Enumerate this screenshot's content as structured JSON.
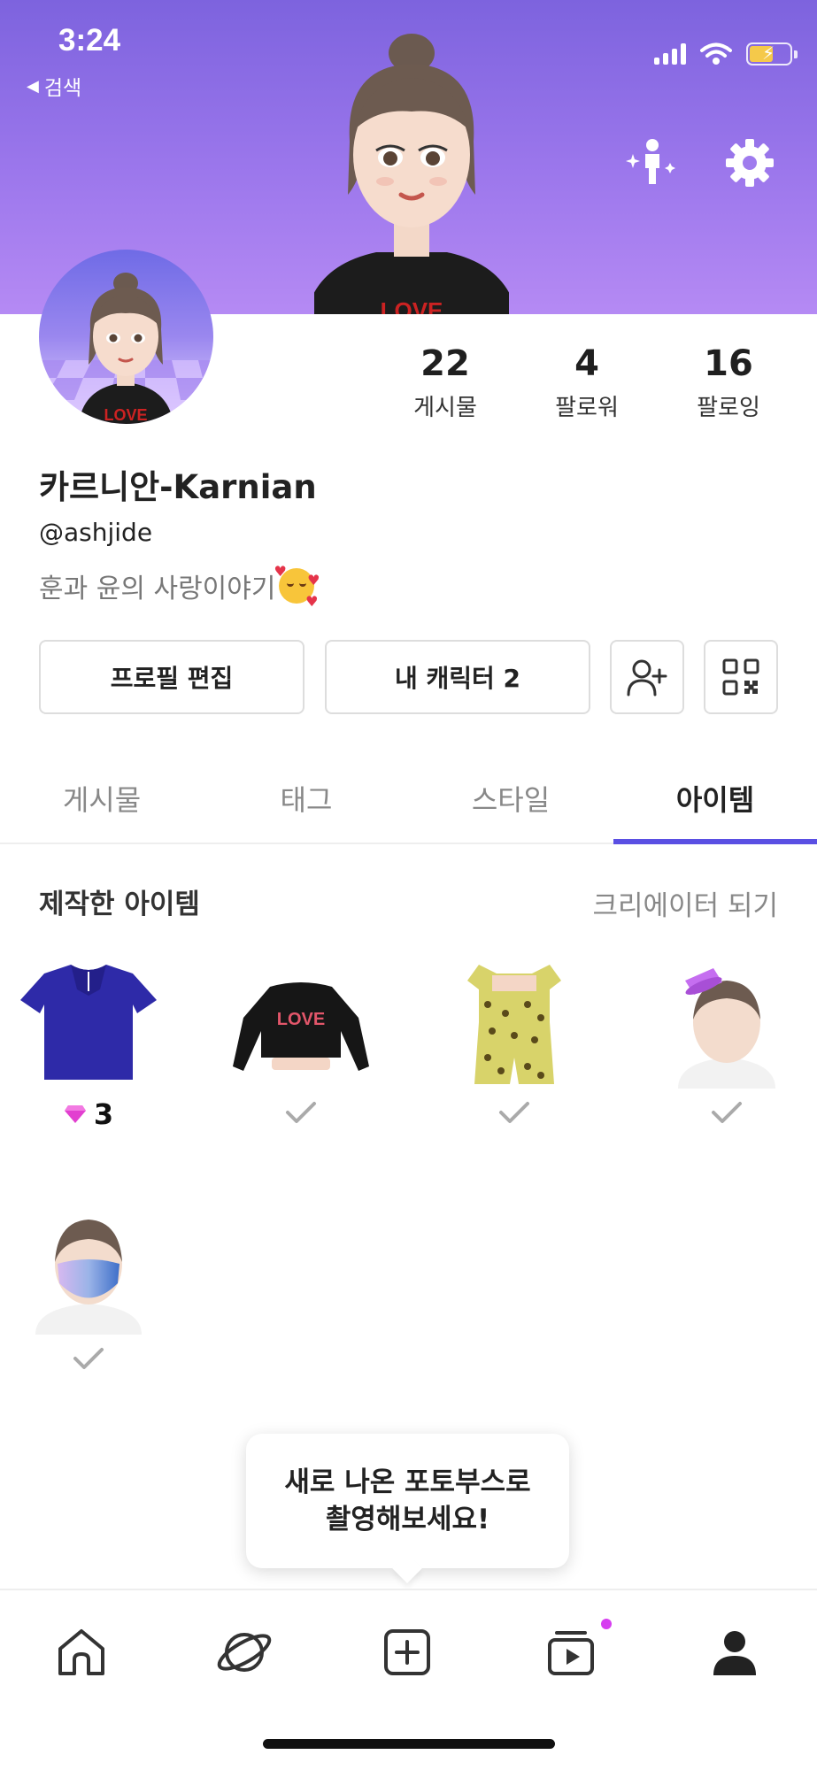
{
  "status_bar": {
    "time": "3:24",
    "back_label": "검색"
  },
  "colors": {
    "accent": "#5a4fe3",
    "header_top": "#7d63de",
    "header_bottom": "#b58af4",
    "notification_dot": "#d63df0",
    "gem": "#e23fd0"
  },
  "header": {
    "icons": [
      "avatar-sparkle-icon",
      "gear-icon"
    ]
  },
  "stats": [
    {
      "value": "22",
      "label": "게시물"
    },
    {
      "value": "4",
      "label": "팔로워"
    },
    {
      "value": "16",
      "label": "팔로잉"
    }
  ],
  "profile": {
    "name": "카르니안-Karnian",
    "handle": "@ashjide",
    "bio": "훈과 윤의 사랑이야기"
  },
  "buttons": {
    "edit_profile": "프로필 편집",
    "my_character": "내 캐릭터 2"
  },
  "tabs": [
    {
      "label": "게시물",
      "active": false
    },
    {
      "label": "태그",
      "active": false
    },
    {
      "label": "스타일",
      "active": false
    },
    {
      "label": "아이템",
      "active": true
    }
  ],
  "items_section": {
    "title": "제작한 아이템",
    "link": "크리에이터 되기",
    "items": [
      {
        "kind": "blue-tshirt",
        "price": "3",
        "status": "price"
      },
      {
        "kind": "black-love-crop-top",
        "status": "owned"
      },
      {
        "kind": "sunflower-romper",
        "status": "owned"
      },
      {
        "kind": "purple-mini-hat",
        "status": "owned"
      },
      {
        "kind": "gradient-mask",
        "status": "owned"
      }
    ]
  },
  "tooltip": {
    "line1": "새로 나온 포토부스로",
    "line2": "촬영해보세요!"
  },
  "bottom_nav": [
    {
      "icon": "home-icon",
      "active": false
    },
    {
      "icon": "planet-icon",
      "active": false
    },
    {
      "icon": "add-square-icon",
      "active": false
    },
    {
      "icon": "video-play-icon",
      "active": false,
      "dot": true
    },
    {
      "icon": "person-icon",
      "active": true
    }
  ]
}
